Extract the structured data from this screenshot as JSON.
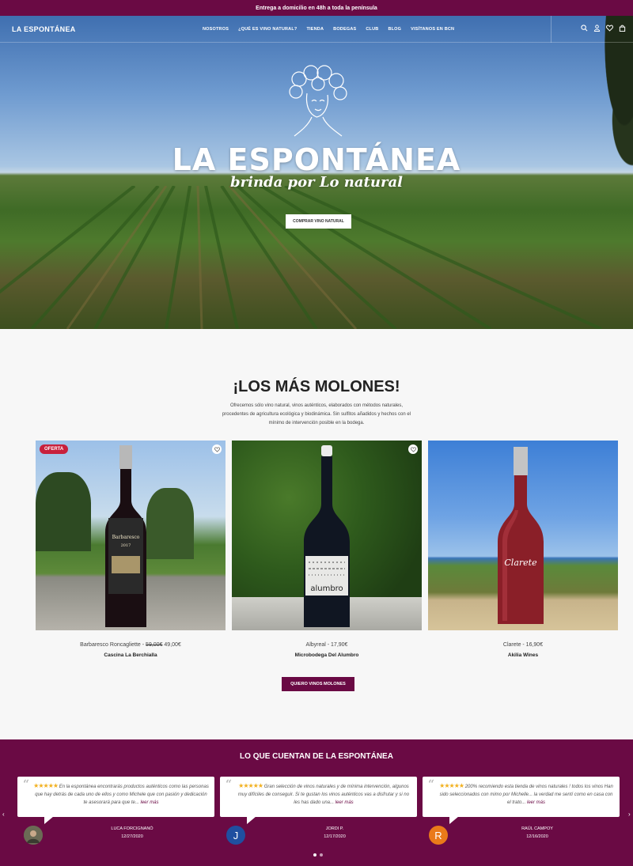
{
  "announcement": "Entrega a domicilio en 48h a toda la península",
  "nav": {
    "logo": "LA ESPONTÁNEA",
    "menu": [
      "NOSOTROS",
      "¿QUÉ ES VINO NATURAL?",
      "TIENDA",
      "BODEGAS",
      "CLUB",
      "BLOG",
      "VISÍTANOS EN BCN"
    ],
    "icons": [
      "search-icon",
      "user-icon",
      "heart-icon",
      "bag-icon"
    ]
  },
  "hero": {
    "brand": "LA ESPONTÁNEA",
    "tagline": "brinda por Lo natural",
    "button": "COMPRAR VINO NATURAL"
  },
  "featured": {
    "title": "¡LOS MÁS MOLONES!",
    "description": "Ofrecemos sólo vino natural, vinos auténticos, elaborados con métodos naturales, procedentes de agricultura ecológica y biodinámica. Sin sulfitos añadidos y hechos con el mínimo de intervención posible en la bodega.",
    "products": [
      {
        "name": "Barbaresco Roncagliette - ",
        "old_price": "59,00€",
        "price": " 49,00€",
        "producer": "Cascina La Berchialla",
        "badge": "OFERTA",
        "bottle_label": "Barbaresco 2017"
      },
      {
        "name": "Albyreal - 17,90€",
        "producer": "Microbodega Del Alumbro",
        "bottle_label": "alumbro"
      },
      {
        "name": "Clarete - 16,90€",
        "producer": "Akilia Wines",
        "bottle_label": "Clarete"
      }
    ],
    "cta": "QUIERO VINOS MOLONES"
  },
  "reviews": {
    "title": "LO QUE CUENTAN DE LA ESPONTÁNEA",
    "stars": "★★★★★",
    "more": "leer más",
    "items": [
      {
        "text": " En la espontánea encontrarás productos auténticos como las personas que hay detrás de cada uno de ellos y como Michele que con pasión y dedicación te asesorará para que te... ",
        "author": "LUCA FORCIGNANÒ",
        "date": "12/27/2020",
        "initial": ""
      },
      {
        "text": " Gran selección de vinos naturales y de mínima intervención, algunos muy difíciles de conseguir. Si te gustan los vinos auténticos vas a disfrutar y si no les has dado una... ",
        "author": "JORDI P.",
        "date": "12/17/2020",
        "initial": "J"
      },
      {
        "text": " 200% recomiendo esta tienda de vinos naturales ! todos los vinos Han sido seleccionados con mimo por Michelle... la verdad me sentí como en casa con el trato... ",
        "author": "RAÜL CAMPOY",
        "date": "12/16/2020",
        "initial": "R"
      }
    ],
    "avatar_colors": [
      "#5a5a4a",
      "#1f4fa0",
      "#ea7a1a"
    ],
    "prev": "‹",
    "next": "›"
  },
  "colors": {
    "brand": "#6a0a44",
    "badge": "#c8203c",
    "star": "#f2b01e"
  }
}
